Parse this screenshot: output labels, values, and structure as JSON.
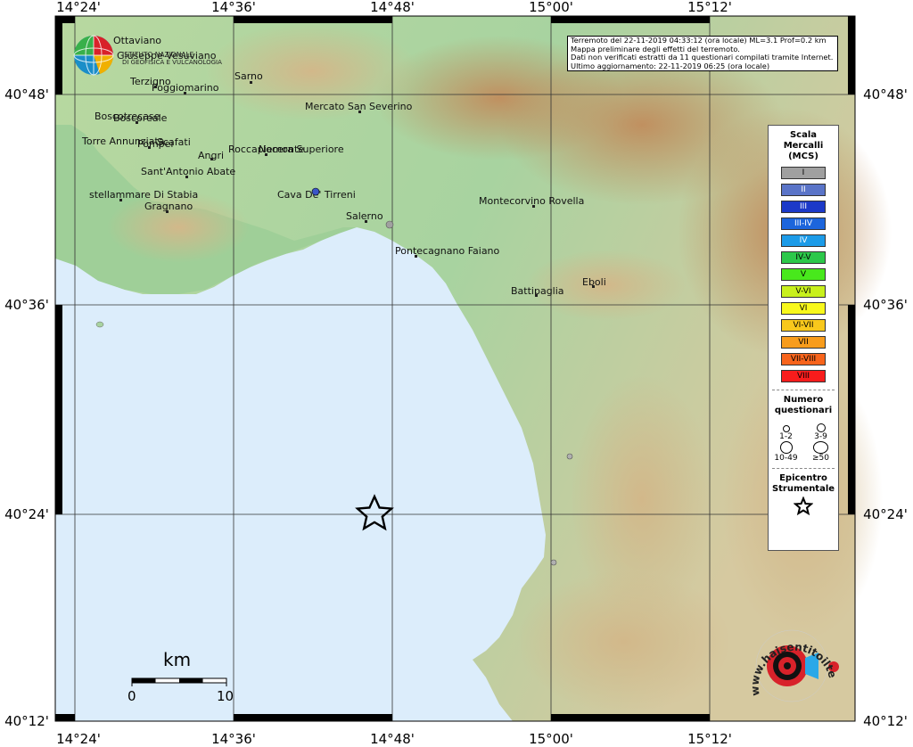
{
  "axes": {
    "lon_ticks": [
      "14°24'",
      "14°36'",
      "14°48'",
      "15°00'",
      "15°12'"
    ],
    "lat_ticks": [
      "40°48'",
      "40°36'",
      "40°24'",
      "40°12'"
    ]
  },
  "info": {
    "lines": [
      "Terremoto del 22-11-2019 04:33:12 (ora locale) ML=3.1 Prof=0.2 km",
      "Mappa preliminare degli effetti del terremoto.",
      "Dati non verificati estratti da 11 questionari compilati tramite Internet.",
      "Ultimo aggiornamento: 22-11-2019 06:25 (ora locale)"
    ]
  },
  "logo": {
    "line1": "ISTITUTO NAZIONALE",
    "line2": "DI GEOFISICA E VULCANOLOGIA"
  },
  "towns": [
    {
      "name": "Ottaviano"
    },
    {
      "name": "Giuseppe Vesuviano"
    },
    {
      "name": "Terzigno"
    },
    {
      "name": "Poggiomarino"
    },
    {
      "name": "Sarno"
    },
    {
      "name": "Boscotrecase"
    },
    {
      "name": "Boscoreale"
    },
    {
      "name": "Mercato San Severino"
    },
    {
      "name": "Torre Annunziata"
    },
    {
      "name": "Pompei"
    },
    {
      "name": "Scafati"
    },
    {
      "name": "Angri"
    },
    {
      "name": "Roccapiemonte"
    },
    {
      "name": "Nocera Superiore"
    },
    {
      "name": "Sant'Antonio Abate"
    },
    {
      "name": "stellammare Di Stabia"
    },
    {
      "name": "Gragnano"
    },
    {
      "name": "Cava De' Tirreni"
    },
    {
      "name": "Salerno"
    },
    {
      "name": "Montecorvino Rovella"
    },
    {
      "name": "Pontecagnano Faiano"
    },
    {
      "name": "Eboli"
    },
    {
      "name": "Battipaglia"
    }
  ],
  "legend": {
    "mcs_title": [
      "Scala",
      "Mercalli",
      "(MCS)"
    ],
    "mcs_levels": [
      {
        "label": "I",
        "color": "#a0a0a0"
      },
      {
        "label": "II",
        "color": "#5a74c8"
      },
      {
        "label": "III",
        "color": "#1c39c8"
      },
      {
        "label": "III-IV",
        "color": "#1c65dc"
      },
      {
        "label": "IV",
        "color": "#1c9be8"
      },
      {
        "label": "IV-V",
        "color": "#2cc84a"
      },
      {
        "label": "V",
        "color": "#48e81c"
      },
      {
        "label": "V-VI",
        "color": "#c8f01c"
      },
      {
        "label": "VI",
        "color": "#f8f81c"
      },
      {
        "label": "VI-VII",
        "color": "#f8c81c"
      },
      {
        "label": "VII",
        "color": "#f89c1c"
      },
      {
        "label": "VII-VIII",
        "color": "#f8641c"
      },
      {
        "label": "VIII",
        "color": "#f81c1c"
      }
    ],
    "q_title": [
      "Numero",
      "questionari"
    ],
    "q_classes": [
      "1-2",
      "3-9",
      "10-49",
      "≥50"
    ],
    "epi_title": [
      "Epicentro",
      "Strumentale"
    ]
  },
  "scale_bar": {
    "unit": "km",
    "min": "0",
    "max": "10"
  },
  "badge": {
    "text": "www.haisentitoilterremoto.it ?"
  },
  "colors": {
    "sea": "#dcedfb",
    "coastal_land": "#a8d3a0",
    "hills": "#d8c8a0",
    "mountains": "#c8a070",
    "accent_red": "#d8222a"
  }
}
